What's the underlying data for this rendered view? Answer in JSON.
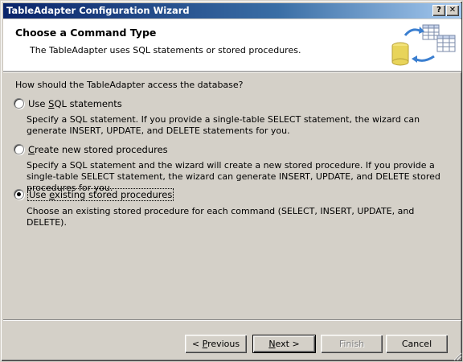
{
  "window": {
    "title": "TableAdapter Configuration Wizard",
    "help_label": "?",
    "close_label": "✕"
  },
  "header": {
    "title": "Choose a Command Type",
    "subtitle": "The TableAdapter uses SQL statements or stored procedures.",
    "icon": "database-transfer-icon"
  },
  "question": "How should the TableAdapter access the database?",
  "options": [
    {
      "label": "Use SQL statements",
      "accel_index": 4,
      "selected": false,
      "description": "Specify a SQL statement. If you provide a single-table SELECT statement, the wizard can generate INSERT, UPDATE, and DELETE statements for you."
    },
    {
      "label": "Create new stored procedures",
      "accel_index": 0,
      "selected": false,
      "description": "Specify a SQL statement and the wizard will create a new stored procedure. If you provide a single-table SELECT statement, the wizard can generate INSERT, UPDATE, and DELETE stored procedures for you."
    },
    {
      "label": "Use existing stored procedures",
      "accel_index": 4,
      "selected": true,
      "description": "Choose an existing stored procedure for each command (SELECT, INSERT, UPDATE, and DELETE)."
    }
  ],
  "buttons": {
    "previous": "< Previous",
    "next": "Next >",
    "finish": "Finish",
    "cancel": "Cancel"
  },
  "colors": {
    "dialog_bg": "#d4d0c8",
    "title_bar_start": "#0a246a",
    "title_bar_end": "#a6caf0"
  }
}
